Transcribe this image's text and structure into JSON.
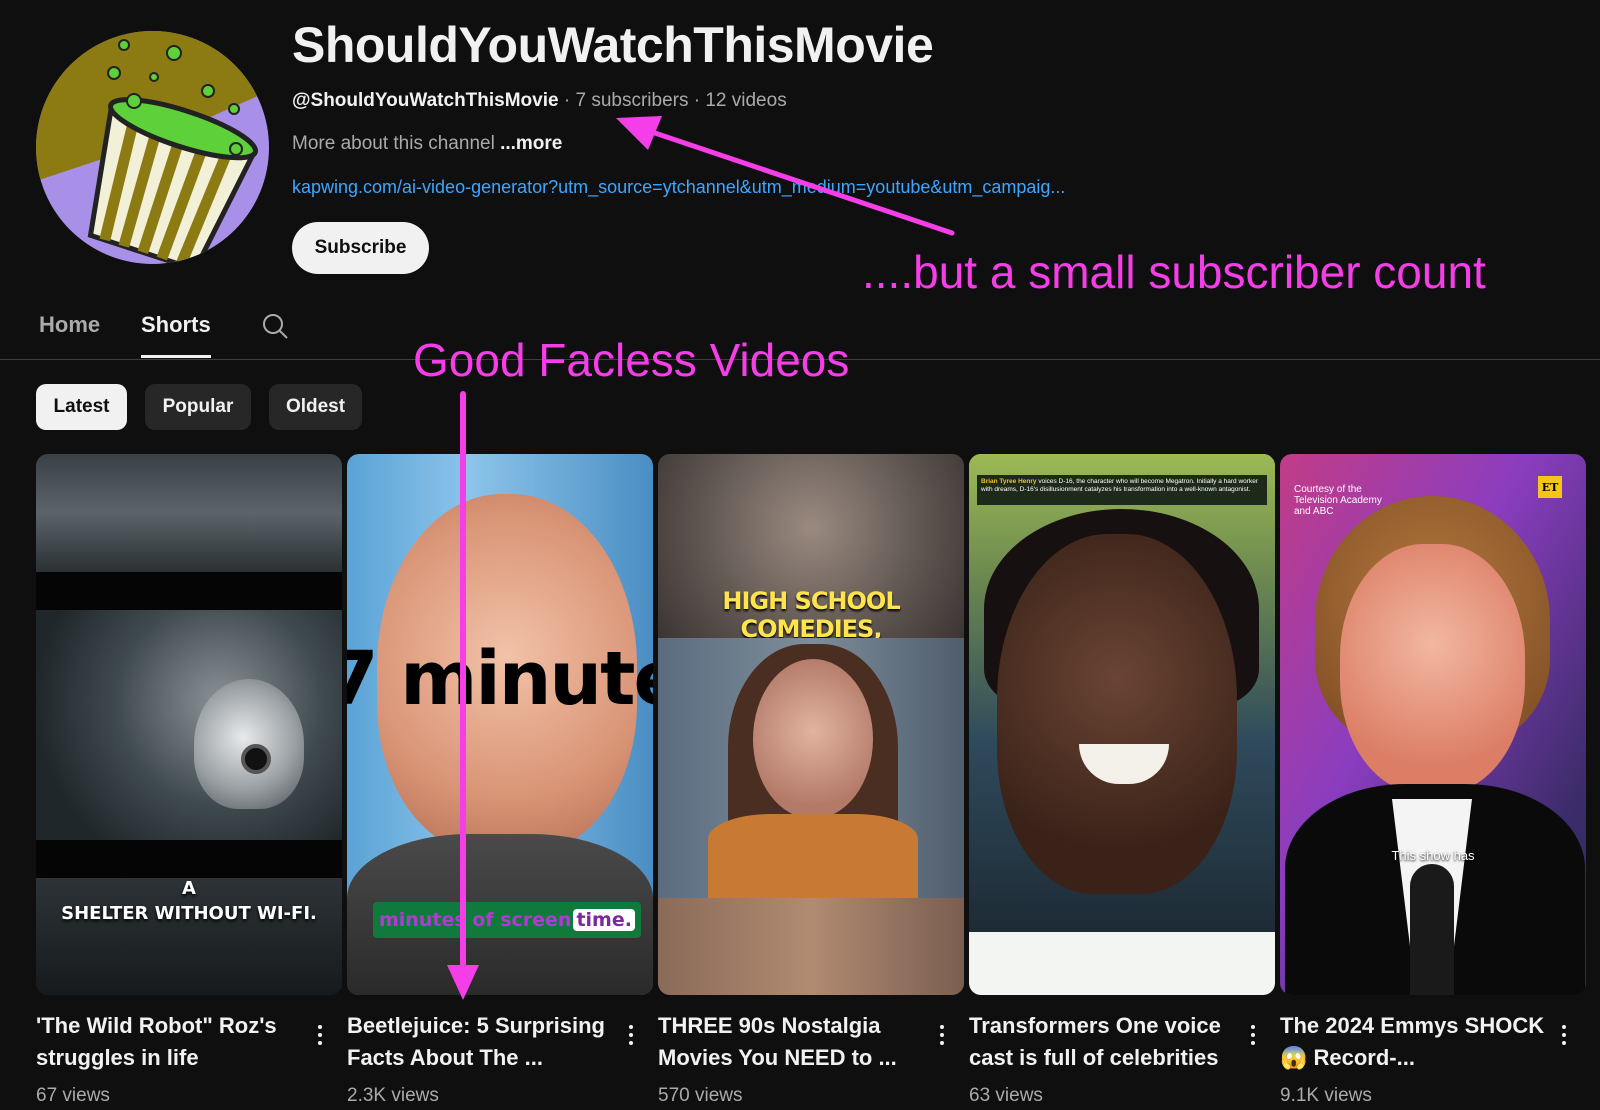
{
  "channel": {
    "name": "ShouldYouWatchThisMovie",
    "handle": "@ShouldYouWatchThisMovie",
    "separator": "·",
    "subscribers": "7 subscribers",
    "videos": "12 videos",
    "about_text": "More about this channel",
    "more_label": "...more",
    "link": "kapwing.com/ai-video-generator?utm_source=ytchannel&utm_medium=youtube&utm_campaig...",
    "subscribe_label": "Subscribe",
    "avatar_icon": "popcorn-bucket-icon"
  },
  "tabs": [
    {
      "label": "Home",
      "active": false
    },
    {
      "label": "Shorts",
      "active": true
    }
  ],
  "search_icon": "search-icon",
  "filters": [
    {
      "label": "Latest",
      "active": true
    },
    {
      "label": "Popular",
      "active": false
    },
    {
      "label": "Oldest",
      "active": false
    }
  ],
  "shorts": [
    {
      "title": "'The Wild Robot\" Roz's struggles in life",
      "views": "67 views",
      "caption_line1": "A",
      "caption_line2": "SHELTER WITHOUT WI-FI."
    },
    {
      "title": "Beetlejuice: 5 Surprising Facts About The ...",
      "views": "2.3K views",
      "big_text": "7 minute",
      "caption": "minutes of screen",
      "caption_highlight": "time."
    },
    {
      "title": "THREE 90s Nostalgia Movies You NEED to ...",
      "views": "570 views",
      "overlay_text": "HIGH SCHOOL COMEDIES,"
    },
    {
      "title": "Transformers One voice cast is full of celebrities",
      "views": "63 views",
      "caption_name": "Brian Tyree Henry",
      "caption_rest": "voices D-16, the character who will become Megatron. Initially a hard worker with dreams, D-16's disillusionment catalyzes his transformation into a well-known antagonist."
    },
    {
      "title": "The 2024 Emmys SHOCK 😱  Record-...",
      "views": "9.1K views",
      "courtesy": "Courtesy of the Television Academy and ABC",
      "logo": "ET",
      "subtitle": "This show has"
    }
  ],
  "annotations": {
    "subscriber_note": "....but a small subscriber count",
    "faceless_note": "Good Facless Videos",
    "color": "#f53ee8"
  },
  "colors": {
    "background": "#0f0f0f",
    "link": "#3ea6ff",
    "chip": "#272727",
    "text_secondary": "#aaaaaa"
  }
}
